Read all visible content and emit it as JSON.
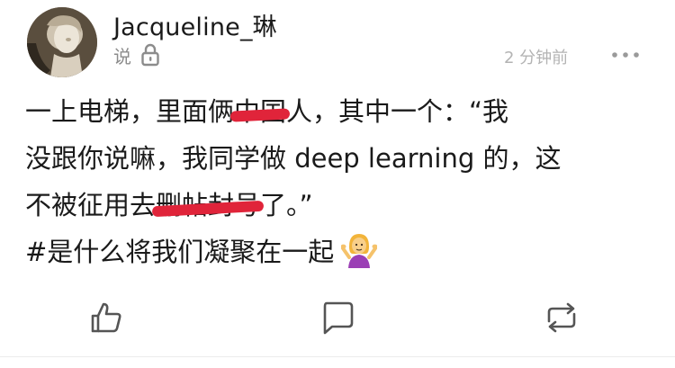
{
  "post": {
    "username": "Jacqueline_琳",
    "visibility_label": "说",
    "timestamp": "2 分钟前",
    "content": {
      "line1": {
        "before": "一上电梯，里面俩",
        "redacted": "中国",
        "after": "人，其中一个：“我"
      },
      "line2": "没跟你说嘛，我同学做 deep learning 的，这",
      "line3": {
        "before": "不被征用去",
        "redacted": "删帖封号",
        "after": "了。”"
      },
      "line4": "#是什么将我们凝聚在一起"
    },
    "emoji_name": "person-shrugging-emoji"
  },
  "icons": {
    "lock": "lock-icon",
    "more": "more-dots-icon",
    "like": "thumbs-up-icon",
    "comment": "comment-bubble-icon",
    "repost": "repost-arrows-icon"
  },
  "colors": {
    "redaction": "#e0243a",
    "muted_text": "#8c8c8c",
    "icon_gray": "#555555"
  }
}
